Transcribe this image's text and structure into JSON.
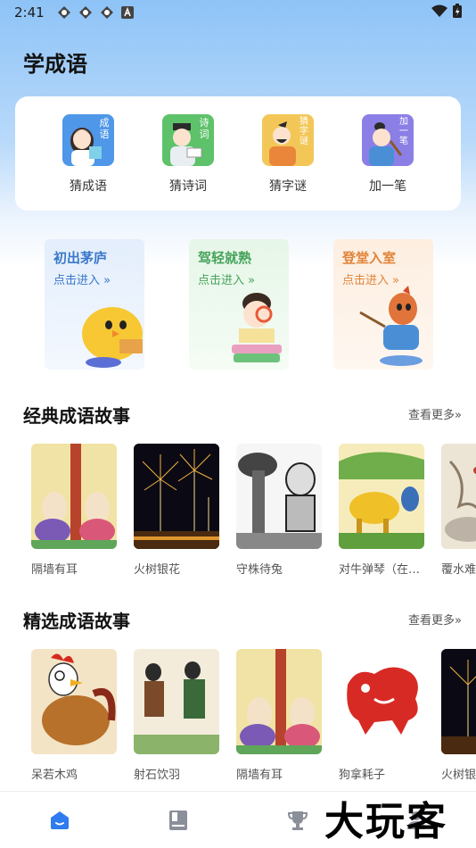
{
  "status_bar": {
    "time": "2:41"
  },
  "page_title": "学成语",
  "games": [
    {
      "label": "猜成语",
      "tag": "成语",
      "icon": "idiom-girl-icon",
      "bg": "#4f97e8"
    },
    {
      "label": "猜诗词",
      "tag": "诗词",
      "icon": "poetry-scholar-icon",
      "bg": "#5ec26a"
    },
    {
      "label": "猜字谜",
      "tag": "猜字谜",
      "icon": "riddle-man-icon",
      "bg": "#f3c757"
    },
    {
      "label": "加一笔",
      "tag": "加一笔",
      "icon": "add-stroke-boy-icon",
      "bg": "#8b7fe6"
    }
  ],
  "levels": [
    {
      "title": "初出茅庐",
      "sub": "点击进入 »",
      "color": "#3a78c9",
      "bg": "#e3eefc",
      "icon": "yellow-chick-icon"
    },
    {
      "title": "驾轻就熟",
      "sub": "点击进入 »",
      "color": "#45a35a",
      "bg": "#e6f6e8",
      "icon": "reading-boy-icon"
    },
    {
      "title": "登堂入室",
      "sub": "点击进入 »",
      "color": "#e0843a",
      "bg": "#fdeee0",
      "icon": "horse-scholar-icon"
    }
  ],
  "classic_section": {
    "title": "经典成语故事",
    "more": "查看更多»",
    "stories": [
      {
        "label": "隔墙有耳",
        "icon": "wall-ears-illustration"
      },
      {
        "label": "火树银花",
        "icon": "fireworks-illustration"
      },
      {
        "label": "守株待兔",
        "icon": "tree-stump-illustration"
      },
      {
        "label": "对牛弹琴（在…",
        "icon": "ox-lute-illustration"
      },
      {
        "label": "覆水难",
        "icon": "spilled-water-illustration"
      }
    ]
  },
  "featured_section": {
    "title": "精选成语故事",
    "more": "查看更多»",
    "stories": [
      {
        "label": "呆若木鸡",
        "icon": "rooster-illustration"
      },
      {
        "label": "射石饮羽",
        "icon": "archer-illustration"
      },
      {
        "label": "隔墙有耳",
        "icon": "wall-ears-illustration"
      },
      {
        "label": "狗拿耗子",
        "icon": "dog-papercut-illustration"
      },
      {
        "label": "火树银",
        "icon": "fireworks-illustration"
      }
    ]
  },
  "tabs": [
    {
      "name": "home",
      "icon": "home-icon",
      "active": true
    },
    {
      "name": "book",
      "icon": "book-icon",
      "active": false
    },
    {
      "name": "trophy",
      "icon": "trophy-icon",
      "active": false
    }
  ],
  "watermark": "大玩客",
  "colors": {
    "accent": "#2f7bf0",
    "title": "#111111"
  }
}
